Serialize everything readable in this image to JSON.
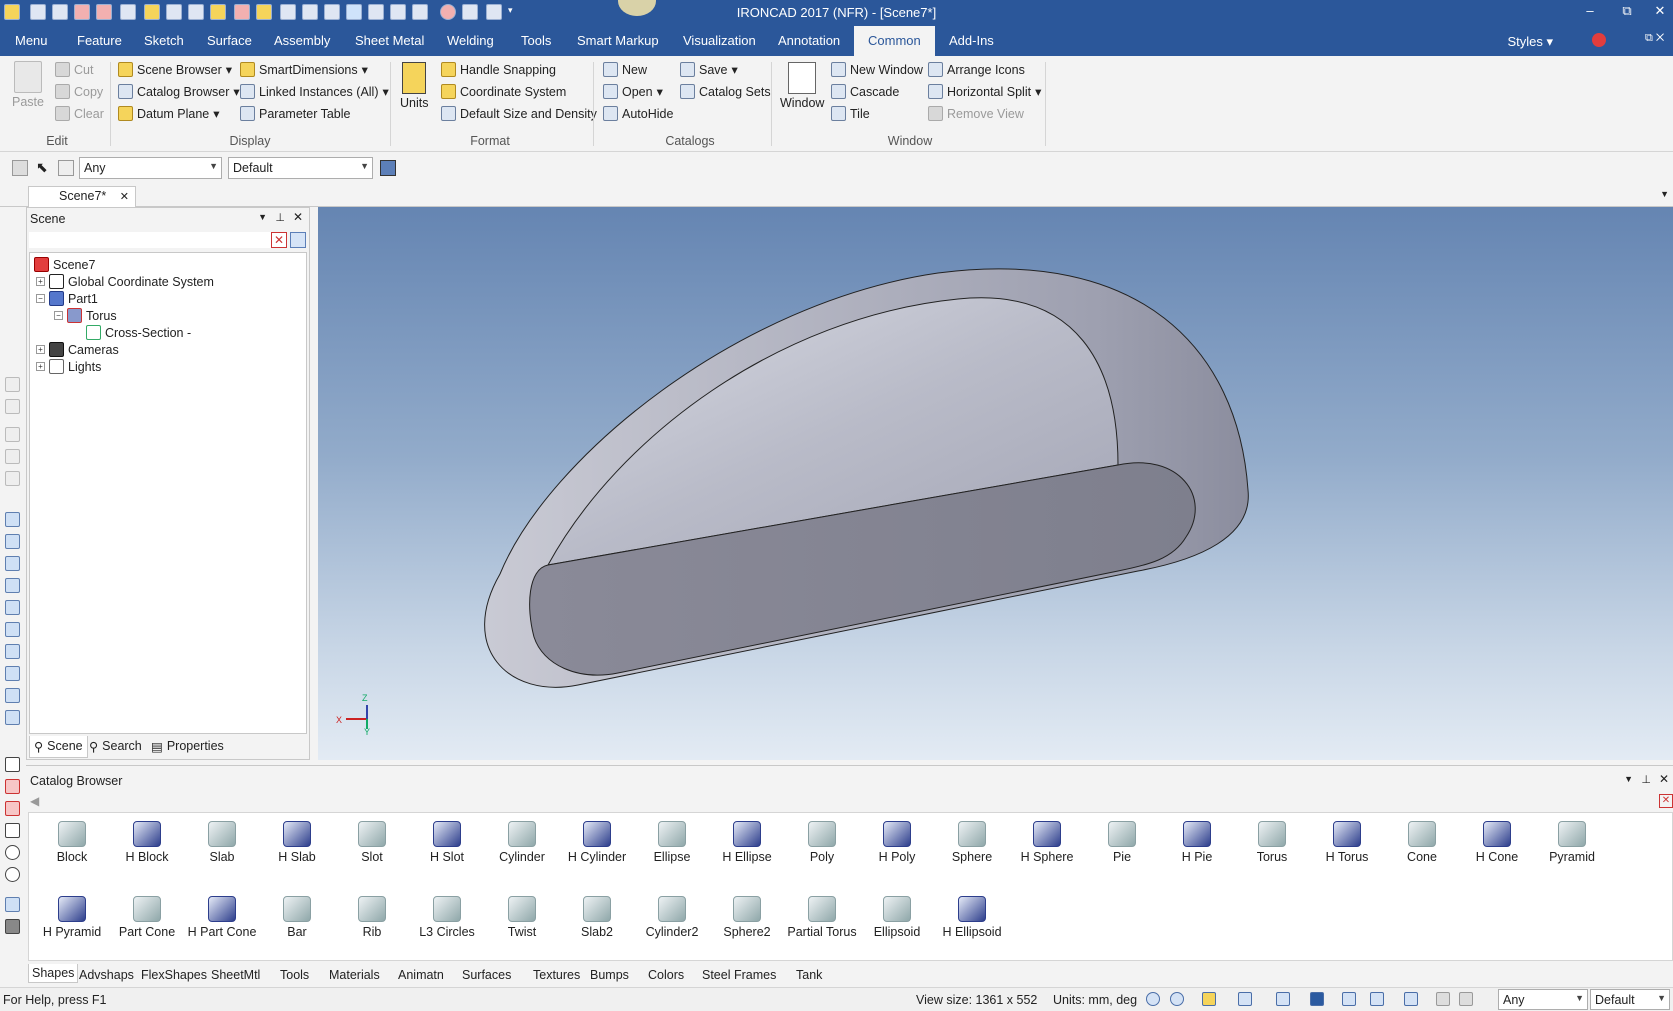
{
  "window": {
    "title": "IRONCAD 2017 (NFR) - [Scene7*]",
    "minimize": "–",
    "restore": "⧉",
    "close": "✕"
  },
  "menu": {
    "tabs": [
      "Menu",
      "Feature",
      "Sketch",
      "Surface",
      "Assembly",
      "Sheet Metal",
      "Welding",
      "Tools",
      "Smart Markup",
      "Visualization",
      "Annotation",
      "Common",
      "Add-Ins"
    ],
    "active": "Common",
    "styles": "Styles"
  },
  "ribbon": {
    "edit": {
      "paste": "Paste",
      "cut": "Cut",
      "copy": "Copy",
      "clear": "Clear",
      "group": "Edit"
    },
    "display": {
      "scene_browser": "Scene Browser",
      "catalog_browser": "Catalog Browser",
      "datum_plane": "Datum Plane",
      "smart_dimensions": "SmartDimensions",
      "linked_instances": "Linked Instances (All)",
      "parameter_table": "Parameter Table",
      "group": "Display"
    },
    "format": {
      "units": "Units",
      "handle_snapping": "Handle Snapping",
      "coordinate_system": "Coordinate System",
      "default_size": "Default Size and Density",
      "group": "Format"
    },
    "catalogs": {
      "new": "New",
      "open": "Open",
      "autohide": "AutoHide",
      "save": "Save",
      "catalog_sets": "Catalog Sets",
      "group": "Catalogs"
    },
    "window": {
      "window": "Window",
      "new_window": "New Window",
      "cascade": "Cascade",
      "tile": "Tile",
      "arrange_icons": "Arrange Icons",
      "horizontal_split": "Horizontal Split",
      "remove_view": "Remove View",
      "group": "Window"
    }
  },
  "toolbar": {
    "filter": "Any",
    "style": "Default"
  },
  "doc_tab": {
    "label": "Scene7*",
    "close": "✕"
  },
  "scene_panel": {
    "title": "Scene",
    "tree": {
      "root": "Scene7",
      "gcs": "Global Coordinate System",
      "part": "Part1",
      "torus": "Torus",
      "cross_section": "Cross-Section -",
      "cameras": "Cameras",
      "lights": "Lights"
    },
    "tabs": [
      "Scene",
      "Search",
      "Properties"
    ]
  },
  "viewport": {
    "axis_z": "Z",
    "axis_x": "X",
    "axis_y": "Y"
  },
  "catalog": {
    "title": "Catalog Browser",
    "items": [
      "Block",
      "H Block",
      "Slab",
      "H Slab",
      "Slot",
      "H Slot",
      "Cylinder",
      "H Cylinder",
      "Ellipse",
      "H Ellipse",
      "Poly",
      "H Poly",
      "Sphere",
      "H Sphere",
      "Pie",
      "H Pie",
      "Torus",
      "H Torus",
      "Cone",
      "H Cone",
      "Pyramid",
      "H Pyramid",
      "Part Cone",
      "H Part Cone",
      "Bar",
      "Rib",
      "L3 Circles",
      "Twist",
      "Slab2",
      "Cylinder2",
      "Sphere2",
      "Partial Torus",
      "Ellipsoid",
      "H Ellipsoid"
    ],
    "tabs": [
      "Shapes",
      "Advshaps",
      "FlexShapes",
      "SheetMtl",
      "Tools",
      "Materials",
      "Animatn",
      "Surfaces",
      "Textures",
      "Bumps",
      "Colors",
      "Steel Frames",
      "Tank"
    ]
  },
  "status": {
    "help": "For Help, press F1",
    "view_size": "View size: 1361 x  552",
    "units": "Units: mm, deg",
    "filter": "Any",
    "style": "Default"
  }
}
